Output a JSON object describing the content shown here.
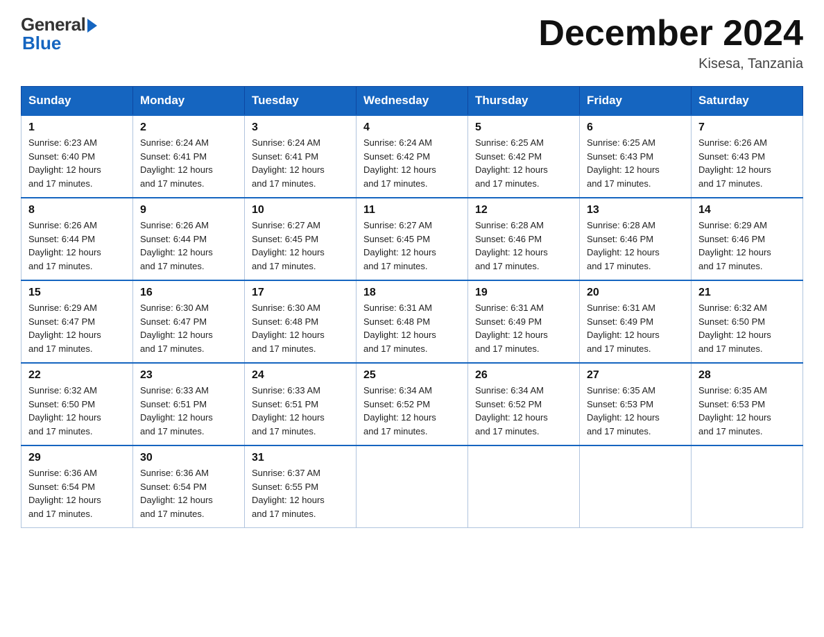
{
  "header": {
    "logo_general": "General",
    "logo_blue": "Blue",
    "title": "December 2024",
    "location": "Kisesa, Tanzania"
  },
  "weekdays": [
    "Sunday",
    "Monday",
    "Tuesday",
    "Wednesday",
    "Thursday",
    "Friday",
    "Saturday"
  ],
  "weeks": [
    [
      {
        "day": "1",
        "sunrise": "6:23 AM",
        "sunset": "6:40 PM",
        "daylight": "12 hours and 17 minutes."
      },
      {
        "day": "2",
        "sunrise": "6:24 AM",
        "sunset": "6:41 PM",
        "daylight": "12 hours and 17 minutes."
      },
      {
        "day": "3",
        "sunrise": "6:24 AM",
        "sunset": "6:41 PM",
        "daylight": "12 hours and 17 minutes."
      },
      {
        "day": "4",
        "sunrise": "6:24 AM",
        "sunset": "6:42 PM",
        "daylight": "12 hours and 17 minutes."
      },
      {
        "day": "5",
        "sunrise": "6:25 AM",
        "sunset": "6:42 PM",
        "daylight": "12 hours and 17 minutes."
      },
      {
        "day": "6",
        "sunrise": "6:25 AM",
        "sunset": "6:43 PM",
        "daylight": "12 hours and 17 minutes."
      },
      {
        "day": "7",
        "sunrise": "6:26 AM",
        "sunset": "6:43 PM",
        "daylight": "12 hours and 17 minutes."
      }
    ],
    [
      {
        "day": "8",
        "sunrise": "6:26 AM",
        "sunset": "6:44 PM",
        "daylight": "12 hours and 17 minutes."
      },
      {
        "day": "9",
        "sunrise": "6:26 AM",
        "sunset": "6:44 PM",
        "daylight": "12 hours and 17 minutes."
      },
      {
        "day": "10",
        "sunrise": "6:27 AM",
        "sunset": "6:45 PM",
        "daylight": "12 hours and 17 minutes."
      },
      {
        "day": "11",
        "sunrise": "6:27 AM",
        "sunset": "6:45 PM",
        "daylight": "12 hours and 17 minutes."
      },
      {
        "day": "12",
        "sunrise": "6:28 AM",
        "sunset": "6:46 PM",
        "daylight": "12 hours and 17 minutes."
      },
      {
        "day": "13",
        "sunrise": "6:28 AM",
        "sunset": "6:46 PM",
        "daylight": "12 hours and 17 minutes."
      },
      {
        "day": "14",
        "sunrise": "6:29 AM",
        "sunset": "6:46 PM",
        "daylight": "12 hours and 17 minutes."
      }
    ],
    [
      {
        "day": "15",
        "sunrise": "6:29 AM",
        "sunset": "6:47 PM",
        "daylight": "12 hours and 17 minutes."
      },
      {
        "day": "16",
        "sunrise": "6:30 AM",
        "sunset": "6:47 PM",
        "daylight": "12 hours and 17 minutes."
      },
      {
        "day": "17",
        "sunrise": "6:30 AM",
        "sunset": "6:48 PM",
        "daylight": "12 hours and 17 minutes."
      },
      {
        "day": "18",
        "sunrise": "6:31 AM",
        "sunset": "6:48 PM",
        "daylight": "12 hours and 17 minutes."
      },
      {
        "day": "19",
        "sunrise": "6:31 AM",
        "sunset": "6:49 PM",
        "daylight": "12 hours and 17 minutes."
      },
      {
        "day": "20",
        "sunrise": "6:31 AM",
        "sunset": "6:49 PM",
        "daylight": "12 hours and 17 minutes."
      },
      {
        "day": "21",
        "sunrise": "6:32 AM",
        "sunset": "6:50 PM",
        "daylight": "12 hours and 17 minutes."
      }
    ],
    [
      {
        "day": "22",
        "sunrise": "6:32 AM",
        "sunset": "6:50 PM",
        "daylight": "12 hours and 17 minutes."
      },
      {
        "day": "23",
        "sunrise": "6:33 AM",
        "sunset": "6:51 PM",
        "daylight": "12 hours and 17 minutes."
      },
      {
        "day": "24",
        "sunrise": "6:33 AM",
        "sunset": "6:51 PM",
        "daylight": "12 hours and 17 minutes."
      },
      {
        "day": "25",
        "sunrise": "6:34 AM",
        "sunset": "6:52 PM",
        "daylight": "12 hours and 17 minutes."
      },
      {
        "day": "26",
        "sunrise": "6:34 AM",
        "sunset": "6:52 PM",
        "daylight": "12 hours and 17 minutes."
      },
      {
        "day": "27",
        "sunrise": "6:35 AM",
        "sunset": "6:53 PM",
        "daylight": "12 hours and 17 minutes."
      },
      {
        "day": "28",
        "sunrise": "6:35 AM",
        "sunset": "6:53 PM",
        "daylight": "12 hours and 17 minutes."
      }
    ],
    [
      {
        "day": "29",
        "sunrise": "6:36 AM",
        "sunset": "6:54 PM",
        "daylight": "12 hours and 17 minutes."
      },
      {
        "day": "30",
        "sunrise": "6:36 AM",
        "sunset": "6:54 PM",
        "daylight": "12 hours and 17 minutes."
      },
      {
        "day": "31",
        "sunrise": "6:37 AM",
        "sunset": "6:55 PM",
        "daylight": "12 hours and 17 minutes."
      },
      null,
      null,
      null,
      null
    ]
  ],
  "labels": {
    "sunrise_prefix": "Sunrise: ",
    "sunset_prefix": "Sunset: ",
    "daylight_prefix": "Daylight: "
  }
}
